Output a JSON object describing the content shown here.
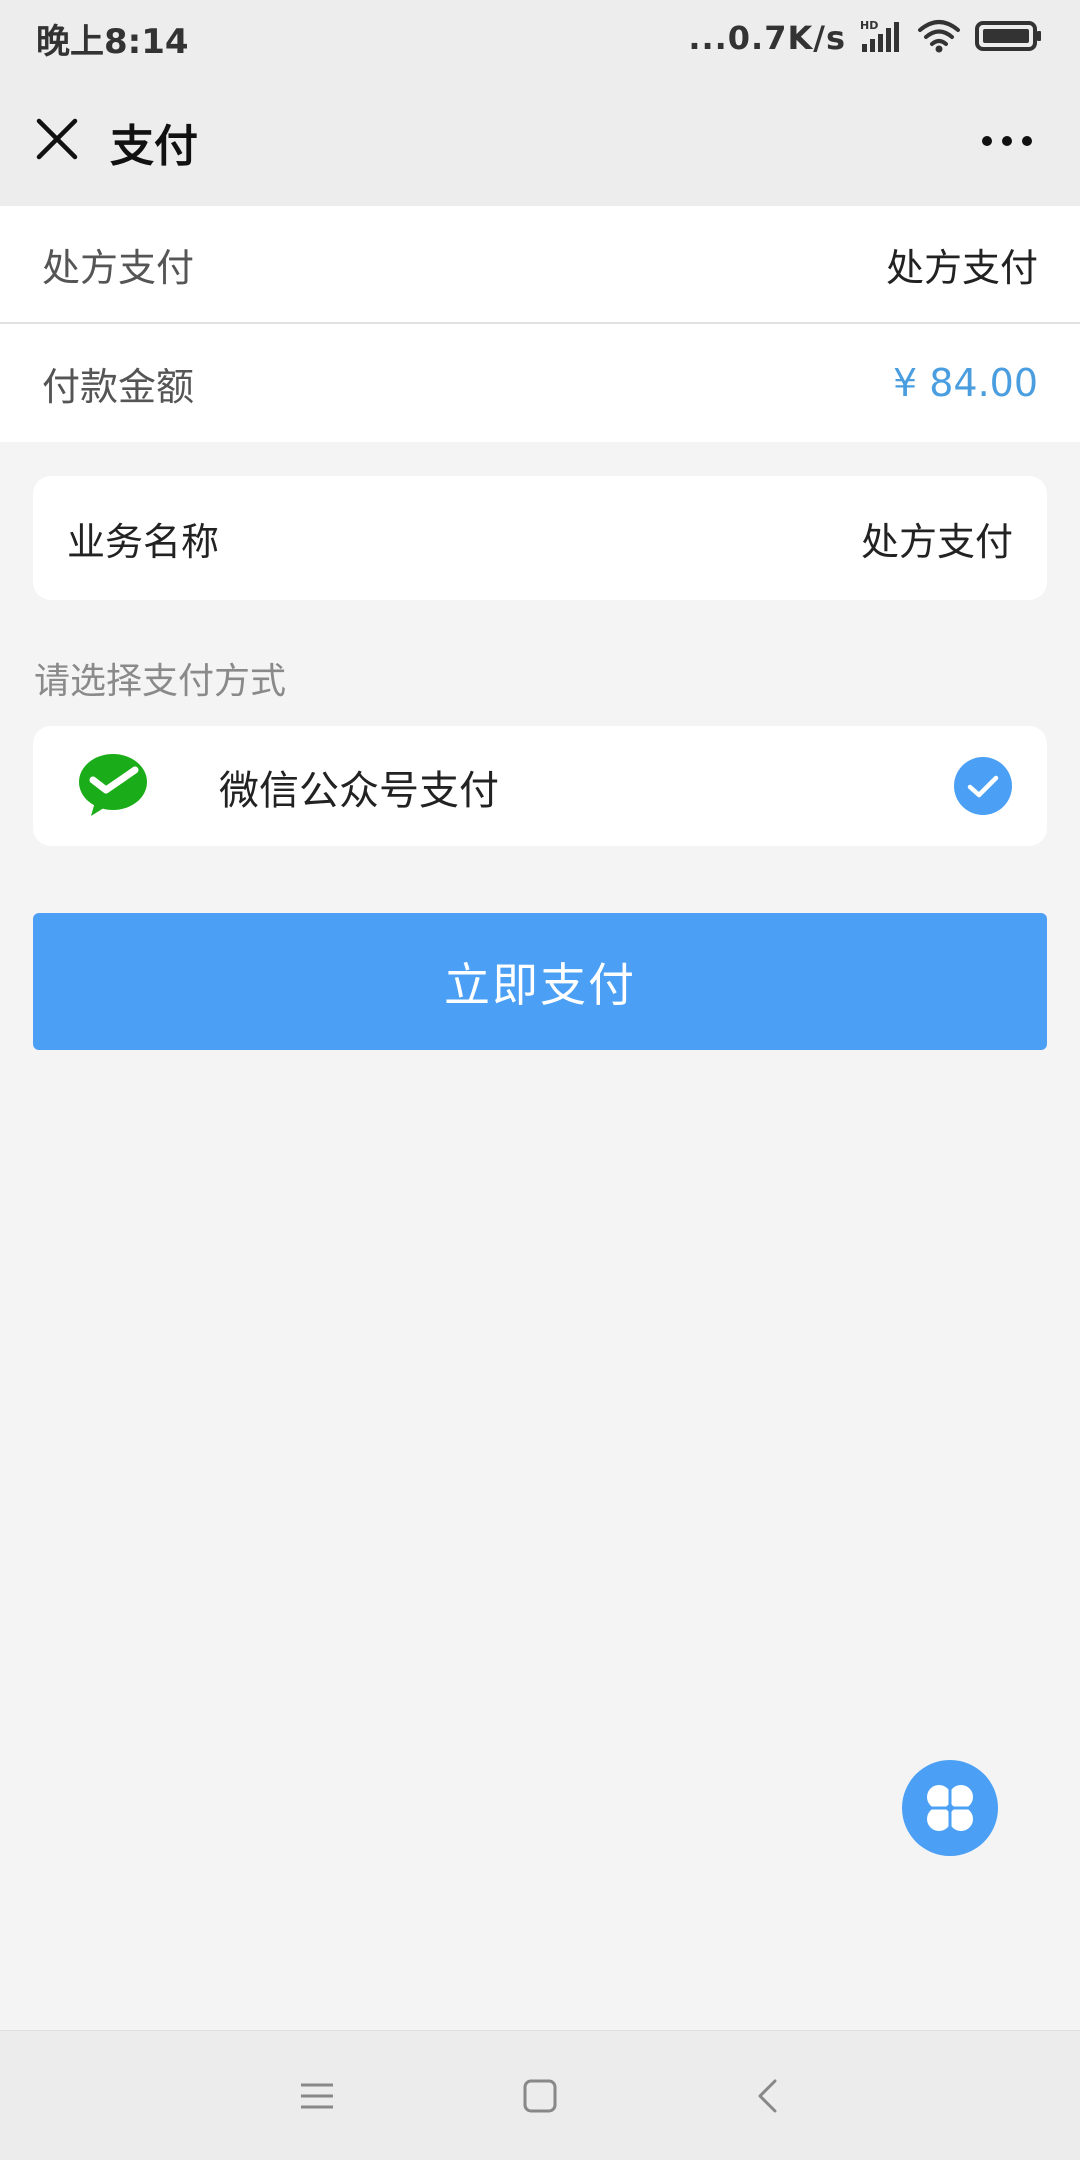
{
  "status_bar": {
    "time": "晚上8:14",
    "network_speed": "...0.7K/s",
    "signal_badge": "HD"
  },
  "nav": {
    "title": "支付",
    "close_icon": "close-icon",
    "more_icon": "more-icon"
  },
  "info_rows": [
    {
      "label": "处方支付",
      "value": "处方支付"
    },
    {
      "label": "付款金额",
      "value": "¥ 84.00"
    }
  ],
  "business": {
    "label": "业务名称",
    "value": "处方支付"
  },
  "payment_section": {
    "label": "请选择支付方式",
    "option_label": "微信公众号支付",
    "option_icon": "wechat-pay-icon",
    "selected": true
  },
  "pay_button_label": "立即支付",
  "colors": {
    "accent": "#4ba0f5",
    "amount": "#4a9ee0",
    "wechat_green": "#1aad19",
    "background": "#f4f4f4"
  }
}
